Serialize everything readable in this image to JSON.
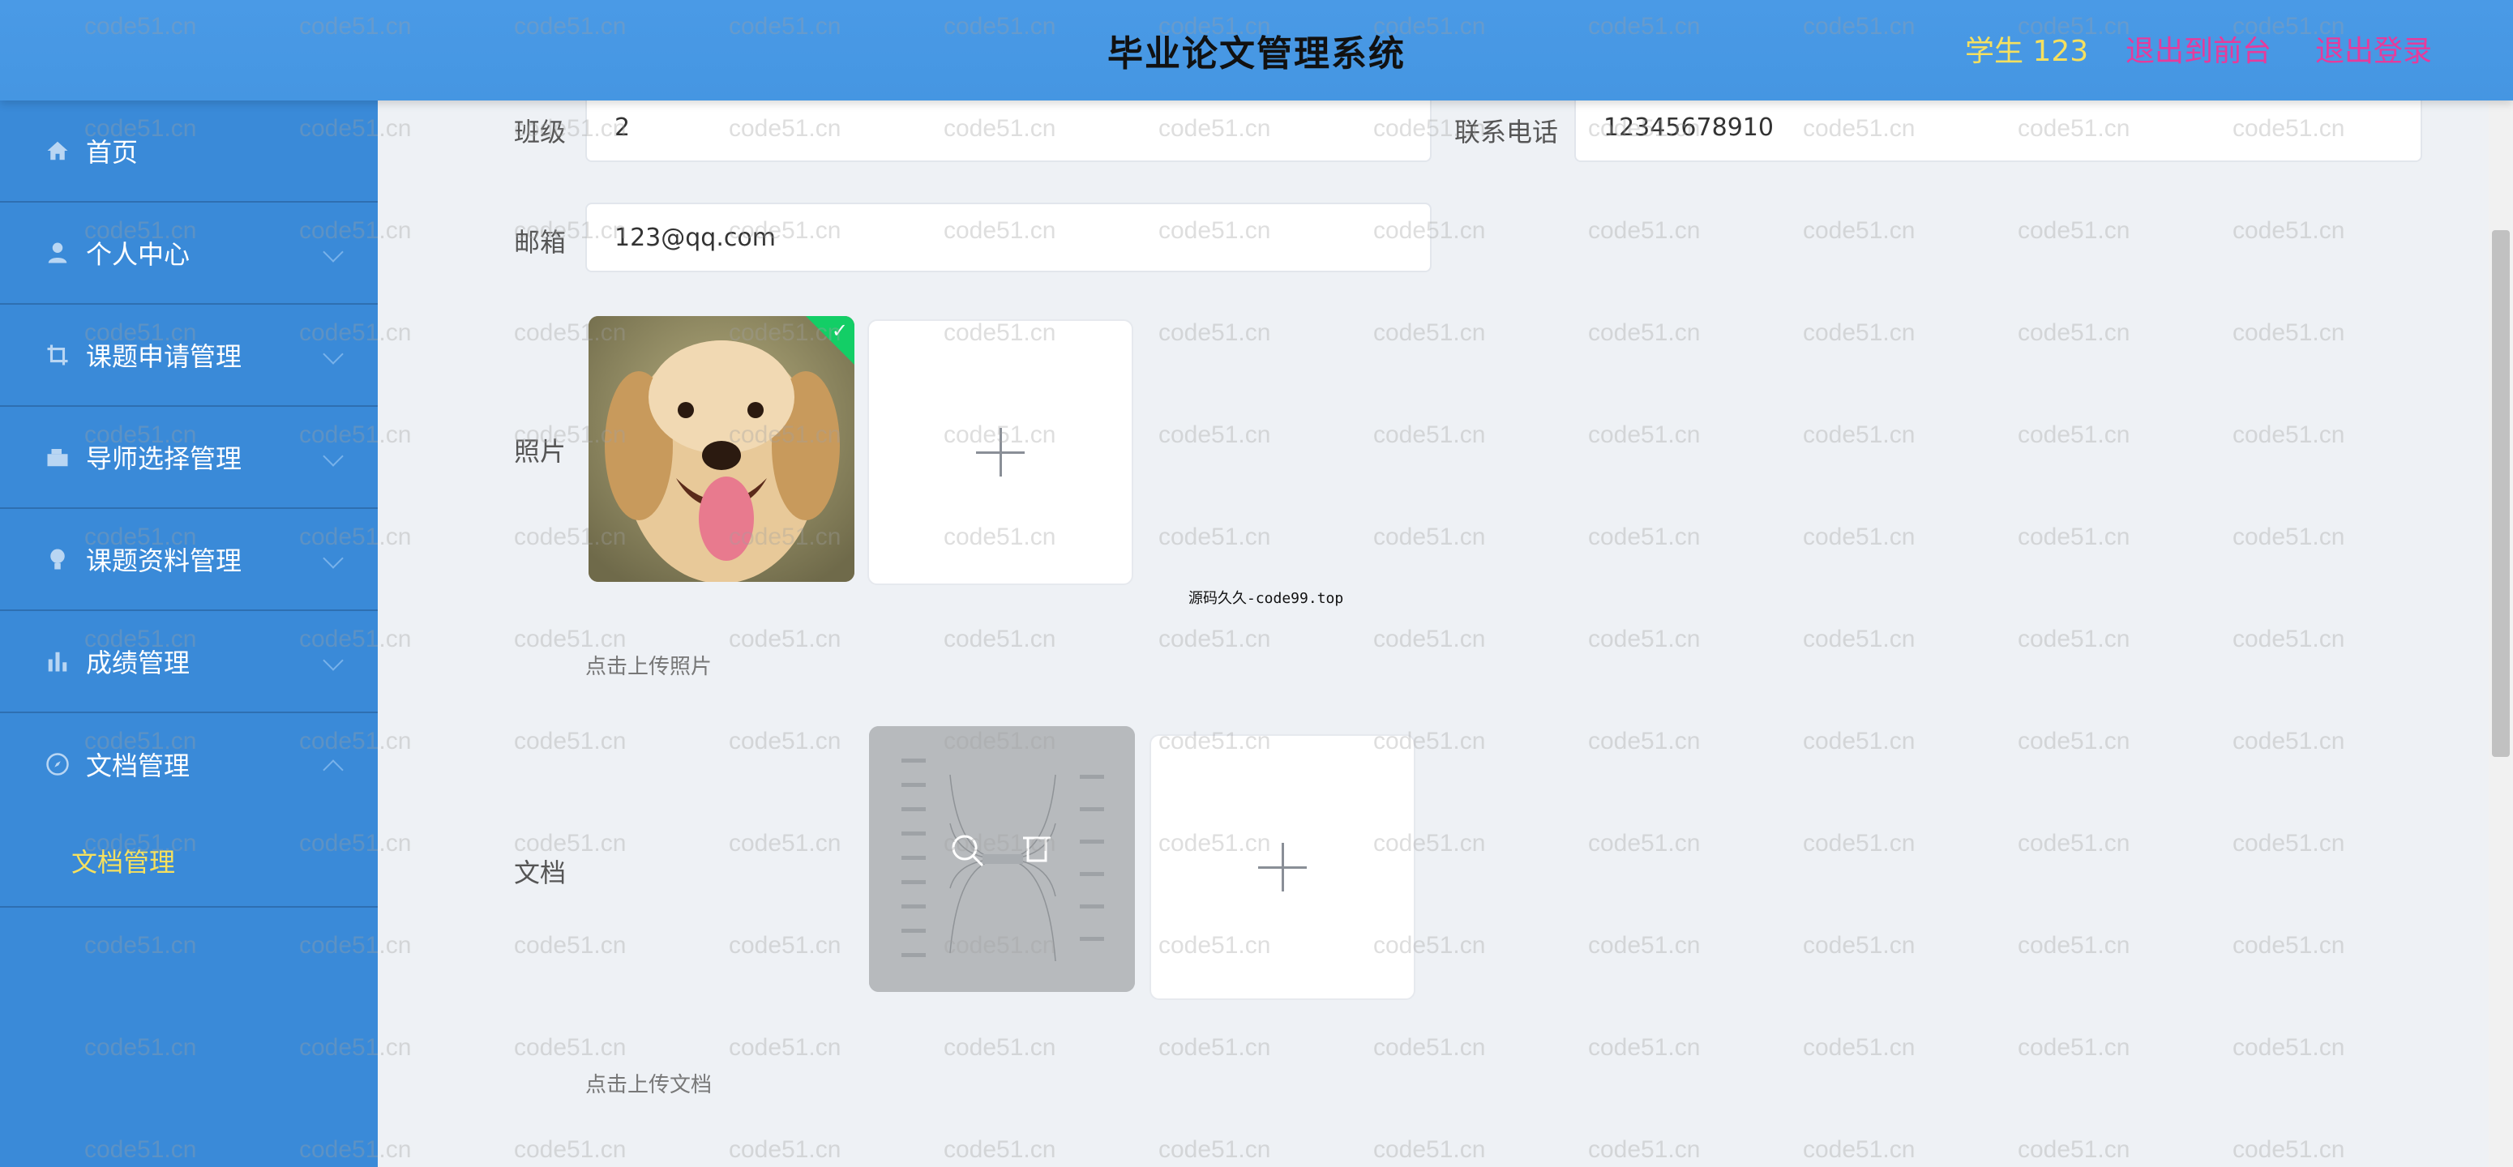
{
  "header": {
    "title": "毕业论文管理系统",
    "user": "学生 123",
    "front_link": "退出到前台",
    "logout_link": "退出登录"
  },
  "sidebar": {
    "items": [
      {
        "label": "首页",
        "icon": "home-icon"
      },
      {
        "label": "个人中心",
        "icon": "user-icon"
      },
      {
        "label": "课题申请管理",
        "icon": "crop-icon"
      },
      {
        "label": "导师选择管理",
        "icon": "box-icon"
      },
      {
        "label": "课题资料管理",
        "icon": "bulb-icon"
      },
      {
        "label": "成绩管理",
        "icon": "bar-chart-icon"
      },
      {
        "label": "文档管理",
        "icon": "compass-icon"
      }
    ],
    "submenu": {
      "label": "文档管理"
    }
  },
  "form": {
    "class_label": "班级",
    "class_value": "2",
    "phone_label": "联系电话",
    "phone_value": "12345678910",
    "email_label": "邮箱",
    "email_value": "123@qq.com",
    "photo_label": "照片",
    "photo_tip": "点击上传照片",
    "doc_label": "文档",
    "doc_tip": "点击上传文档",
    "center_watermark": "源码久久-code99.top"
  },
  "watermark_text": "code51.cn",
  "colors": {
    "header_bg": "#4a9ae6",
    "sidebar_bg": "#3a8ad8",
    "user_color": "#f6e05e",
    "link_color": "#e63b9c",
    "success": "#13ce66"
  }
}
